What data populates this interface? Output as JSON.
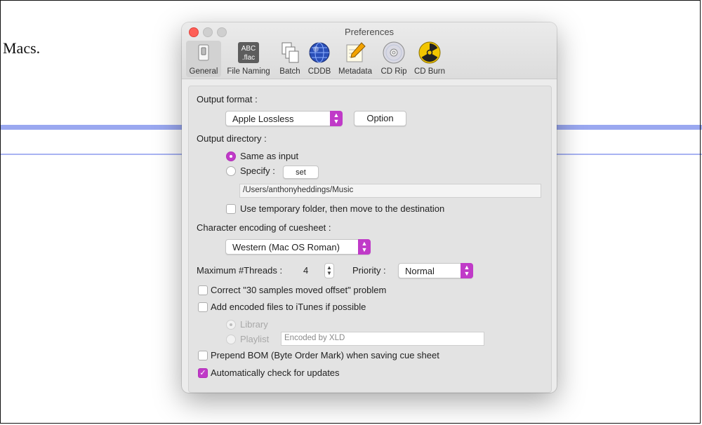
{
  "background": {
    "text": "Macs."
  },
  "window": {
    "title": "Preferences",
    "toolbar": [
      {
        "label": "General",
        "icon": "switch-icon"
      },
      {
        "label": "File Naming",
        "icon": "abc-flac-icon"
      },
      {
        "label": "Batch",
        "icon": "documents-icon"
      },
      {
        "label": "CDDB",
        "icon": "globe-icon"
      },
      {
        "label": "Metadata",
        "icon": "pencil-paper-icon"
      },
      {
        "label": "CD Rip",
        "icon": "cd-icon"
      },
      {
        "label": "CD Burn",
        "icon": "radiation-icon"
      }
    ],
    "abc_icon_text": {
      "top": "ABC",
      "bottom": ".flac"
    }
  },
  "general": {
    "output_format_label": "Output format :",
    "output_format_value": "Apple Lossless",
    "option_button": "Option",
    "output_directory_label": "Output directory :",
    "same_as_input": "Same as input",
    "specify": "Specify :",
    "set_button": "set",
    "directory_path": "/Users/anthonyheddings/Music",
    "temp_folder": "Use temporary folder, then move to the destination",
    "encoding_label": "Character encoding of cuesheet :",
    "encoding_value": "Western (Mac OS Roman)",
    "threads_label": "Maximum #Threads :",
    "threads_value": "4",
    "priority_label": "Priority :",
    "priority_value": "Normal",
    "correct_offset": "Correct \"30 samples moved offset\" problem",
    "add_itunes": "Add encoded files to iTunes if possible",
    "library": "Library",
    "playlist": "Playlist",
    "playlist_placeholder": "Encoded by XLD",
    "prepend_bom": "Prepend BOM (Byte Order Mark) when saving cue sheet",
    "auto_check": "Automatically check for updates"
  },
  "state": {
    "same_as_input_selected": true,
    "temp_folder_checked": false,
    "correct_offset_checked": false,
    "add_itunes_checked": false,
    "library_selected": true,
    "prepend_bom_checked": false,
    "auto_check_checked": true
  },
  "colors": {
    "accent": "#c03ac8",
    "close": "#fe5f57"
  }
}
